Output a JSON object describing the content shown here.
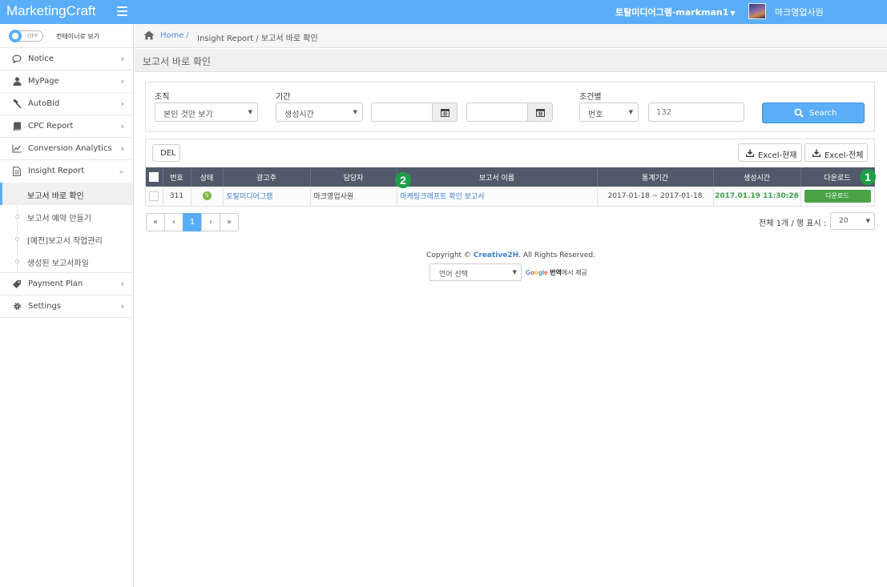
{
  "header": {
    "brand": "MarketingCraft",
    "user_account": "토탈미디어그램-markman1",
    "user_role": "마크영업사원"
  },
  "sidebar": {
    "toggle_state": "OFF",
    "toggle_label": "컨테이너로 보기",
    "items": [
      {
        "label": "Notice",
        "icon": "comment-icon"
      },
      {
        "label": "MyPage",
        "icon": "user-icon"
      },
      {
        "label": "AutoBid",
        "icon": "gavel-icon"
      },
      {
        "label": "CPC Report",
        "icon": "book-icon"
      },
      {
        "label": "Conversion Analytics",
        "icon": "line-chart-icon"
      },
      {
        "label": "Insight Report",
        "icon": "document-icon"
      }
    ],
    "insight_sub": [
      {
        "label": "보고서 바로 확인"
      },
      {
        "label": "보고서 예약 만들기"
      },
      {
        "label": "[예전]보고서 작업관리"
      },
      {
        "label": "생성된 보고서파일"
      }
    ],
    "items_after": [
      {
        "label": "Payment Plan",
        "icon": "tag-icon"
      },
      {
        "label": "Settings",
        "icon": "gear-icon"
      }
    ]
  },
  "breadcrumb": {
    "home": "Home",
    "sep": "/",
    "rest": "Insight Report / 보고서 바로 확인"
  },
  "page_title": "보고서 바로 확인",
  "filters": {
    "org_label": "조직",
    "org_value": "본인 것만 보기",
    "period_label": "기간",
    "period_value": "생성시간",
    "date_from": "",
    "date_to": "",
    "cond_label": "조건별",
    "cond_value": "번호",
    "cond_input": "132",
    "search_label": "Search"
  },
  "actions": {
    "del": "DEL",
    "excel_current": "Excel-현재",
    "excel_all": "Excel-전체"
  },
  "table": {
    "columns": [
      "번호",
      "상태",
      "광고주",
      "담당자",
      "보고서 이름",
      "통계기간",
      "생성시간",
      "다운로드"
    ],
    "rows": [
      {
        "no": "311",
        "status": "S",
        "advertiser": "토탈미디어그램",
        "manager": "마크영업사원",
        "report_name": "마케팅크래프트 확인 보고서",
        "stat_period": "2017-01-18 ~ 2017-01-18",
        "created": "2017.01.19 11:30:26",
        "download": "다운로드"
      }
    ]
  },
  "markers": {
    "one": "1",
    "two": "2"
  },
  "pagination": {
    "first": "«",
    "prev": "‹",
    "current": "1",
    "next": "›",
    "last": "»",
    "total_text": "전체 1개 / 행 표시 :",
    "per_page": "20"
  },
  "footer": {
    "copyright_prefix": "Copyright © ",
    "copyright_brand": "Creative2H",
    "copyright_suffix": ". All Rights Reserved.",
    "language_select": "언어 선택",
    "google": "Google",
    "translate": "번역",
    "translate_suffix": "에서 제공"
  },
  "colors": {
    "accent": "#5aaef7",
    "header_dark": "#505a6a",
    "success": "#4aa346",
    "link": "#3c7fc7"
  }
}
